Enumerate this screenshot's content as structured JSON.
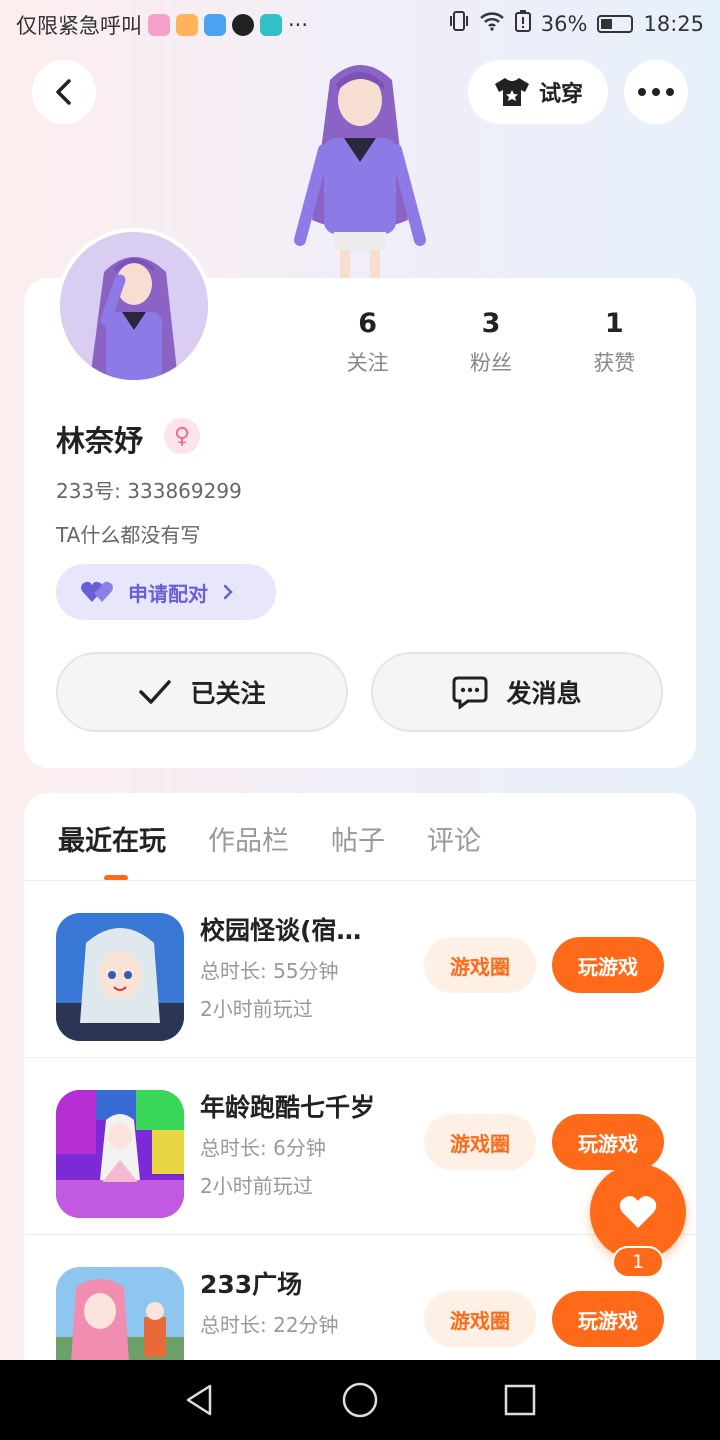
{
  "status_bar": {
    "carrier_text": "仅限紧急呼叫",
    "more_indicator": "···",
    "battery_percent": "36%",
    "time": "18:25",
    "app_icon_colors": [
      "#f5a0c8",
      "#ffb35a",
      "#4aa3f0",
      "#222222",
      "#30c0c8"
    ]
  },
  "header": {
    "try_on_label": "试穿"
  },
  "profile": {
    "stats": [
      {
        "value": "6",
        "label": "关注"
      },
      {
        "value": "3",
        "label": "粉丝"
      },
      {
        "value": "1",
        "label": "获赞"
      }
    ],
    "name": "林奈妤",
    "gender_symbol": "♀",
    "user_id": "233号: 333869299",
    "bio": "TA什么都没有写",
    "match_label": "申请配对",
    "follow_label": "已关注",
    "message_label": "发消息"
  },
  "tabs": [
    {
      "label": "最近在玩",
      "active": true
    },
    {
      "label": "作品栏",
      "active": false
    },
    {
      "label": "帖子",
      "active": false
    },
    {
      "label": "评论",
      "active": false
    }
  ],
  "games": [
    {
      "title": "校园怪谈(宿…",
      "duration": "总时长: 55分钟",
      "last_played": "2小时前玩过",
      "circle_label": "游戏圈",
      "play_label": "玩游戏"
    },
    {
      "title": "年龄跑酷七千岁",
      "duration": "总时长: 6分钟",
      "last_played": "2小时前玩过",
      "circle_label": "游戏圈",
      "play_label": "玩游戏"
    },
    {
      "title": "233广场",
      "duration": "总时长: 22分钟",
      "last_played": "",
      "circle_label": "游戏圈",
      "play_label": "玩游戏"
    }
  ],
  "like_fab": {
    "count": "1"
  },
  "colors": {
    "accent": "#ff6a1a",
    "match_purple": "#6b5fd8"
  }
}
